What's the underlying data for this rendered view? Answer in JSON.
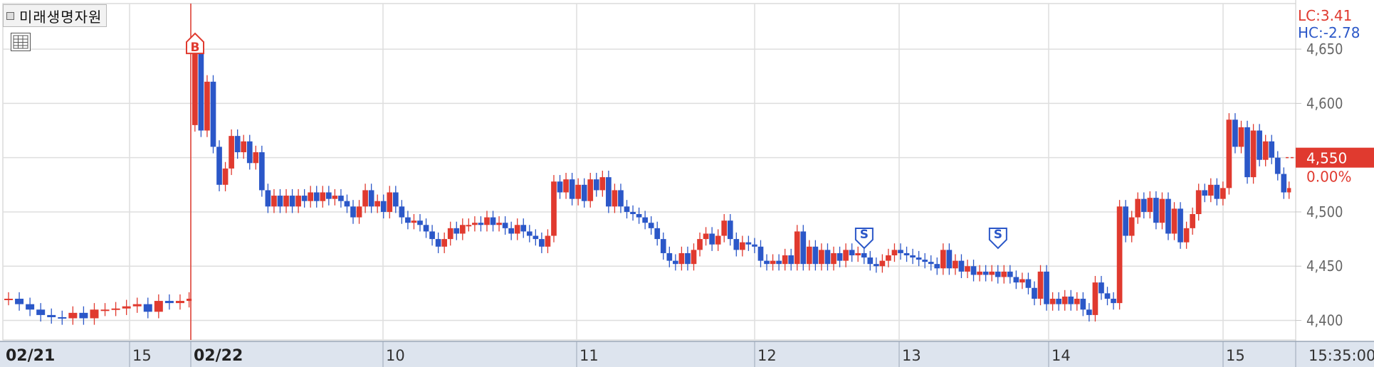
{
  "title": "미래생명자원",
  "chart_data": {
    "type": "candlestick",
    "upColor": "#e03a2f",
    "downColor": "#2b57c8",
    "y_ticks": [
      "4,650",
      "4,600",
      "4,550",
      "4,500",
      "4,450",
      "4,400"
    ],
    "y_tick_values": [
      4650,
      4600,
      4550,
      4500,
      4450,
      4400
    ],
    "ylim": [
      4382,
      4692
    ],
    "x_ticks": [
      {
        "label": "02/21",
        "bold": true
      },
      {
        "label": "15",
        "bold": false
      },
      {
        "label": "02/22",
        "bold": true
      },
      {
        "label": "10",
        "bold": false
      },
      {
        "label": "11",
        "bold": false
      },
      {
        "label": "12",
        "bold": false
      },
      {
        "label": "13",
        "bold": false
      },
      {
        "label": "14",
        "bold": false
      },
      {
        "label": "15",
        "bold": false
      }
    ],
    "time_label": "15:35:00",
    "lc_label": "LC:3.41",
    "hc_label": "HC:-2.78",
    "current_price": "4,550",
    "current_change": "0.00%",
    "current_value": 4550,
    "markers": [
      {
        "type": "B",
        "label": "B",
        "price": 4650
      },
      {
        "type": "S",
        "label": "S",
        "price": 4460
      },
      {
        "type": "S",
        "label": "S",
        "price": 4460
      }
    ],
    "series": [
      {
        "o": 4420,
        "c": 4420
      },
      {
        "o": 4420,
        "c": 4415
      },
      {
        "o": 4415,
        "c": 4410
      },
      {
        "o": 4410,
        "c": 4405
      },
      {
        "o": 4405,
        "c": 4403
      },
      {
        "o": 4403,
        "c": 4402
      },
      {
        "o": 4402,
        "c": 4407
      },
      {
        "o": 4407,
        "c": 4402
      },
      {
        "o": 4402,
        "c": 4410
      },
      {
        "o": 4410,
        "c": 4410
      },
      {
        "o": 4410,
        "c": 4411
      },
      {
        "o": 4411,
        "c": 4413
      },
      {
        "o": 4413,
        "c": 4415
      },
      {
        "o": 4415,
        "c": 4408
      },
      {
        "o": 4408,
        "c": 4418
      },
      {
        "o": 4418,
        "c": 4416
      },
      {
        "o": 4416,
        "c": 4418
      },
      {
        "o": 4418,
        "c": 4420
      },
      {
        "o": 4580,
        "c": 4650
      },
      {
        "o": 4650,
        "c": 4575
      },
      {
        "o": 4575,
        "c": 4620
      },
      {
        "o": 4620,
        "c": 4560
      },
      {
        "o": 4560,
        "c": 4525
      },
      {
        "o": 4525,
        "c": 4540
      },
      {
        "o": 4540,
        "c": 4570
      },
      {
        "o": 4570,
        "c": 4555
      },
      {
        "o": 4555,
        "c": 4565
      },
      {
        "o": 4565,
        "c": 4545
      },
      {
        "o": 4545,
        "c": 4555
      },
      {
        "o": 4555,
        "c": 4520
      },
      {
        "o": 4520,
        "c": 4505
      },
      {
        "o": 4505,
        "c": 4515
      },
      {
        "o": 4515,
        "c": 4505
      },
      {
        "o": 4505,
        "c": 4515
      },
      {
        "o": 4515,
        "c": 4505
      },
      {
        "o": 4505,
        "c": 4515
      },
      {
        "o": 4515,
        "c": 4510
      },
      {
        "o": 4510,
        "c": 4518
      },
      {
        "o": 4518,
        "c": 4510
      },
      {
        "o": 4510,
        "c": 4518
      },
      {
        "o": 4518,
        "c": 4512
      },
      {
        "o": 4512,
        "c": 4515
      },
      {
        "o": 4515,
        "c": 4510
      },
      {
        "o": 4510,
        "c": 4505
      },
      {
        "o": 4505,
        "c": 4495
      },
      {
        "o": 4495,
        "c": 4505
      },
      {
        "o": 4505,
        "c": 4520
      },
      {
        "o": 4520,
        "c": 4505
      },
      {
        "o": 4505,
        "c": 4510
      },
      {
        "o": 4510,
        "c": 4500
      },
      {
        "o": 4500,
        "c": 4518
      },
      {
        "o": 4518,
        "c": 4505
      },
      {
        "o": 4505,
        "c": 4495
      },
      {
        "o": 4495,
        "c": 4490
      },
      {
        "o": 4490,
        "c": 4492
      },
      {
        "o": 4492,
        "c": 4488
      },
      {
        "o": 4488,
        "c": 4482
      },
      {
        "o": 4482,
        "c": 4475
      },
      {
        "o": 4475,
        "c": 4468
      },
      {
        "o": 4468,
        "c": 4475
      },
      {
        "o": 4475,
        "c": 4485
      },
      {
        "o": 4485,
        "c": 4480
      },
      {
        "o": 4480,
        "c": 4488
      },
      {
        "o": 4488,
        "c": 4488
      },
      {
        "o": 4488,
        "c": 4490
      },
      {
        "o": 4490,
        "c": 4488
      },
      {
        "o": 4488,
        "c": 4495
      },
      {
        "o": 4495,
        "c": 4488
      },
      {
        "o": 4488,
        "c": 4490
      },
      {
        "o": 4490,
        "c": 4485
      },
      {
        "o": 4485,
        "c": 4480
      },
      {
        "o": 4480,
        "c": 4488
      },
      {
        "o": 4488,
        "c": 4482
      },
      {
        "o": 4482,
        "c": 4478
      },
      {
        "o": 4478,
        "c": 4475
      },
      {
        "o": 4475,
        "c": 4468
      },
      {
        "o": 4468,
        "c": 4478
      },
      {
        "o": 4478,
        "c": 4528
      },
      {
        "o": 4528,
        "c": 4518
      },
      {
        "o": 4518,
        "c": 4530
      },
      {
        "o": 4530,
        "c": 4512
      },
      {
        "o": 4512,
        "c": 4525
      },
      {
        "o": 4525,
        "c": 4510
      },
      {
        "o": 4510,
        "c": 4530
      },
      {
        "o": 4530,
        "c": 4520
      },
      {
        "o": 4520,
        "c": 4532
      },
      {
        "o": 4532,
        "c": 4505
      },
      {
        "o": 4505,
        "c": 4520
      },
      {
        "o": 4520,
        "c": 4505
      },
      {
        "o": 4505,
        "c": 4500
      },
      {
        "o": 4500,
        "c": 4498
      },
      {
        "o": 4498,
        "c": 4495
      },
      {
        "o": 4495,
        "c": 4490
      },
      {
        "o": 4490,
        "c": 4485
      },
      {
        "o": 4485,
        "c": 4475
      },
      {
        "o": 4475,
        "c": 4462
      },
      {
        "o": 4462,
        "c": 4455
      },
      {
        "o": 4455,
        "c": 4452
      },
      {
        "o": 4452,
        "c": 4462
      },
      {
        "o": 4462,
        "c": 4452
      },
      {
        "o": 4452,
        "c": 4465
      },
      {
        "o": 4465,
        "c": 4475
      },
      {
        "o": 4475,
        "c": 4480
      },
      {
        "o": 4480,
        "c": 4470
      },
      {
        "o": 4470,
        "c": 4478
      },
      {
        "o": 4478,
        "c": 4492
      },
      {
        "o": 4492,
        "c": 4475
      },
      {
        "o": 4475,
        "c": 4465
      },
      {
        "o": 4465,
        "c": 4472
      },
      {
        "o": 4472,
        "c": 4470
      },
      {
        "o": 4470,
        "c": 4468
      },
      {
        "o": 4468,
        "c": 4455
      },
      {
        "o": 4455,
        "c": 4452
      },
      {
        "o": 4452,
        "c": 4455
      },
      {
        "o": 4455,
        "c": 4452
      },
      {
        "o": 4452,
        "c": 4460
      },
      {
        "o": 4460,
        "c": 4452
      },
      {
        "o": 4452,
        "c": 4482
      },
      {
        "o": 4482,
        "c": 4452
      },
      {
        "o": 4452,
        "c": 4468
      },
      {
        "o": 4468,
        "c": 4452
      },
      {
        "o": 4452,
        "c": 4465
      },
      {
        "o": 4465,
        "c": 4452
      },
      {
        "o": 4452,
        "c": 4462
      },
      {
        "o": 4462,
        "c": 4455
      },
      {
        "o": 4455,
        "c": 4465
      },
      {
        "o": 4465,
        "c": 4460
      },
      {
        "o": 4460,
        "c": 4462
      },
      {
        "o": 4462,
        "c": 4458
      },
      {
        "o": 4458,
        "c": 4452
      },
      {
        "o": 4452,
        "c": 4450
      },
      {
        "o": 4450,
        "c": 4455
      },
      {
        "o": 4455,
        "c": 4460
      },
      {
        "o": 4460,
        "c": 4465
      },
      {
        "o": 4465,
        "c": 4462
      },
      {
        "o": 4462,
        "c": 4460
      },
      {
        "o": 4460,
        "c": 4458
      },
      {
        "o": 4458,
        "c": 4456
      },
      {
        "o": 4456,
        "c": 4454
      },
      {
        "o": 4454,
        "c": 4452
      },
      {
        "o": 4452,
        "c": 4448
      },
      {
        "o": 4448,
        "c": 4465
      },
      {
        "o": 4465,
        "c": 4448
      },
      {
        "o": 4448,
        "c": 4455
      },
      {
        "o": 4455,
        "c": 4445
      },
      {
        "o": 4445,
        "c": 4450
      },
      {
        "o": 4450,
        "c": 4442
      },
      {
        "o": 4442,
        "c": 4445
      },
      {
        "o": 4445,
        "c": 4442
      },
      {
        "o": 4442,
        "c": 4445
      },
      {
        "o": 4445,
        "c": 4440
      },
      {
        "o": 4440,
        "c": 4445
      },
      {
        "o": 4445,
        "c": 4440
      },
      {
        "o": 4440,
        "c": 4435
      },
      {
        "o": 4435,
        "c": 4438
      },
      {
        "o": 4438,
        "c": 4430
      },
      {
        "o": 4430,
        "c": 4420
      },
      {
        "o": 4420,
        "c": 4445
      },
      {
        "o": 4445,
        "c": 4415
      },
      {
        "o": 4415,
        "c": 4420
      },
      {
        "o": 4420,
        "c": 4415
      },
      {
        "o": 4415,
        "c": 4422
      },
      {
        "o": 4422,
        "c": 4415
      },
      {
        "o": 4415,
        "c": 4420
      },
      {
        "o": 4420,
        "c": 4410
      },
      {
        "o": 4410,
        "c": 4405
      },
      {
        "o": 4405,
        "c": 4435
      },
      {
        "o": 4435,
        "c": 4425
      },
      {
        "o": 4425,
        "c": 4420
      },
      {
        "o": 4420,
        "c": 4416
      },
      {
        "o": 4416,
        "c": 4505
      },
      {
        "o": 4505,
        "c": 4478
      },
      {
        "o": 4478,
        "c": 4495
      },
      {
        "o": 4495,
        "c": 4512
      },
      {
        "o": 4512,
        "c": 4500
      },
      {
        "o": 4500,
        "c": 4513
      },
      {
        "o": 4513,
        "c": 4490
      },
      {
        "o": 4490,
        "c": 4512
      },
      {
        "o": 4512,
        "c": 4480
      },
      {
        "o": 4480,
        "c": 4503
      },
      {
        "o": 4503,
        "c": 4472
      },
      {
        "o": 4472,
        "c": 4485
      },
      {
        "o": 4485,
        "c": 4498
      },
      {
        "o": 4498,
        "c": 4520
      },
      {
        "o": 4520,
        "c": 4515
      },
      {
        "o": 4515,
        "c": 4525
      },
      {
        "o": 4525,
        "c": 4512
      },
      {
        "o": 4512,
        "c": 4522
      },
      {
        "o": 4522,
        "c": 4585
      },
      {
        "o": 4585,
        "c": 4560
      },
      {
        "o": 4560,
        "c": 4578
      },
      {
        "o": 4578,
        "c": 4532
      },
      {
        "o": 4532,
        "c": 4575
      },
      {
        "o": 4575,
        "c": 4548
      },
      {
        "o": 4548,
        "c": 4565
      },
      {
        "o": 4565,
        "c": 4550
      },
      {
        "o": 4550,
        "c": 4535
      },
      {
        "o": 4535,
        "c": 4518
      },
      {
        "o": 4518,
        "c": 4522
      }
    ]
  }
}
